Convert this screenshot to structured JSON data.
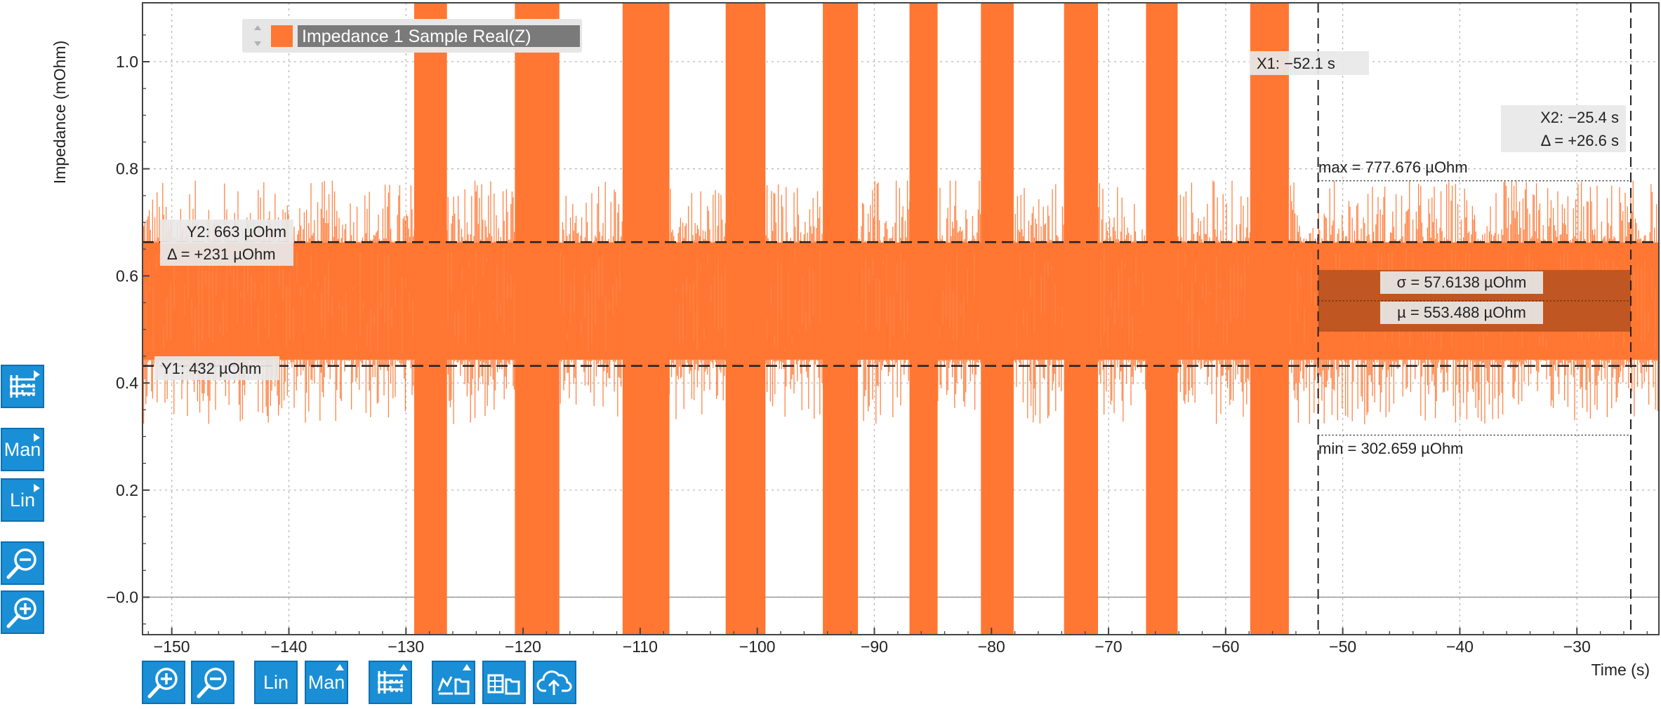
{
  "chart_data": {
    "type": "line",
    "xlabel": "Time (s)",
    "ylabel": "Impedance (mOhm)",
    "xlim": [
      -152.5,
      -23
    ],
    "ylim": [
      -0.07,
      1.11
    ],
    "x_ticks": [
      -150,
      -140,
      -130,
      -120,
      -110,
      -100,
      -90,
      -80,
      -70,
      -60,
      -50,
      -40,
      -30
    ],
    "x_tick_labels": [
      "−150",
      "−140",
      "−130",
      "−120",
      "−110",
      "−100",
      "−90",
      "−80",
      "−70",
      "−60",
      "−50",
      "−40",
      "−30"
    ],
    "y_ticks": [
      0.0,
      0.2,
      0.4,
      0.6,
      0.8,
      1.0
    ],
    "y_tick_labels": [
      "−0.0",
      "0.2",
      "0.4",
      "0.6",
      "0.8",
      "1.0"
    ],
    "grid": true,
    "legend": {
      "position": "top-left",
      "entries": [
        {
          "name": "Impedance 1 Sample Real(Z)",
          "color": "#ff7733"
        }
      ]
    },
    "series": [
      {
        "name": "Impedance 1 Sample Real(Z)",
        "color": "#ff7733",
        "noise_band": {
          "x": [
            -152.5,
            -23
          ],
          "mean": 0.553,
          "sigma": 0.0576,
          "max": 0.778,
          "min": 0.303
        },
        "full_range_bursts": [
          {
            "x_start": -129.3,
            "x_end": -126.5
          },
          {
            "x_start": -120.7,
            "x_end": -116.9
          },
          {
            "x_start": -111.5,
            "x_end": -107.5
          },
          {
            "x_start": -102.7,
            "x_end": -99.3
          },
          {
            "x_start": -94.4,
            "x_end": -91.4
          },
          {
            "x_start": -87.0,
            "x_end": -84.6
          },
          {
            "x_start": -80.9,
            "x_end": -78.1
          },
          {
            "x_start": -73.8,
            "x_end": -70.9
          },
          {
            "x_start": -66.8,
            "x_end": -64.1
          },
          {
            "x_start": -57.9,
            "x_end": -54.6
          }
        ]
      }
    ],
    "cursors": {
      "x1": {
        "value": -52.1,
        "label": "X1: −52.1 s"
      },
      "x2": {
        "value": -25.4,
        "label": "X2: −25.4 s",
        "delta_label": "Δ = +26.6 s"
      },
      "y1": {
        "value": 0.432,
        "label": "Y1: 432 µOhm"
      },
      "y2": {
        "value": 0.663,
        "label": "Y2: 663 µOhm",
        "delta_label": "Δ = +231 µOhm"
      }
    },
    "statistics": {
      "max_label": "max = 777.676 µOhm",
      "min_label": "min = 302.659 µOhm",
      "sigma_label": "σ = 57.6138 µOhm",
      "mu_label": "µ = 553.488 µOhm",
      "max": 0.777676,
      "min": 0.302659,
      "mean": 0.553488,
      "sigma": 0.0576138
    }
  },
  "colors": {
    "signal": "#ff7733",
    "signal_light": "#ff9a5c",
    "stats_band": "#b5501e",
    "tool_button": "#1a8fd6",
    "legend_bg": "#7a7a7a"
  },
  "toolbar_left": [
    {
      "name": "cursor-mode-button",
      "icon": "cursor-grid-icon",
      "label": ""
    },
    {
      "name": "y-range-manual-button",
      "icon": "",
      "label": "Man"
    },
    {
      "name": "y-scale-lin-button",
      "icon": "",
      "label": "Lin"
    },
    {
      "name": "y-zoom-out-button",
      "icon": "zoom-out-icon",
      "label": ""
    },
    {
      "name": "y-zoom-in-button",
      "icon": "zoom-in-icon",
      "label": ""
    }
  ],
  "toolbar_bottom": [
    {
      "name": "x-zoom-in-button",
      "icon": "zoom-in-icon",
      "label": ""
    },
    {
      "name": "x-zoom-out-button",
      "icon": "zoom-out-icon",
      "label": ""
    },
    {
      "name": "x-scale-lin-button",
      "icon": "",
      "label": "Lin"
    },
    {
      "name": "x-range-manual-button",
      "icon": "",
      "label": "Man"
    },
    {
      "name": "x-cursor-mode-button",
      "icon": "cursor-grid-icon",
      "label": ""
    },
    {
      "name": "save-plot-button",
      "icon": "chart-folder-icon",
      "label": ""
    },
    {
      "name": "save-data-button",
      "icon": "table-folder-icon",
      "label": ""
    },
    {
      "name": "upload-cloud-button",
      "icon": "cloud-upload-icon",
      "label": ""
    }
  ]
}
